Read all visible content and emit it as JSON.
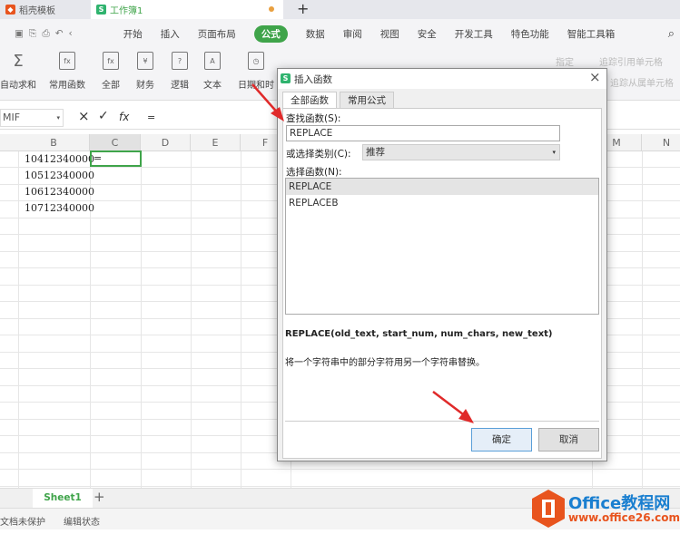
{
  "tabs": [
    {
      "label": "稻壳模板",
      "icon": "docer-logo-icon",
      "color": "#e8541e"
    },
    {
      "label": "工作簿1",
      "icon": "spreadsheet-logo-icon",
      "color": "#2fb36e"
    }
  ],
  "new_tab": "+",
  "menu": [
    "开始",
    "插入",
    "页面布局",
    "公式",
    "数据",
    "审阅",
    "视图",
    "安全",
    "开发工具",
    "特色功能",
    "智能工具箱"
  ],
  "menu_active": "公式",
  "ribbon": [
    {
      "label": "自动求和",
      "icon": "Σ"
    },
    {
      "label": "常用函数",
      "icon": "fx"
    },
    {
      "label": "全部",
      "icon": "fx"
    },
    {
      "label": "财务",
      "icon": "¥"
    },
    {
      "label": "逻辑",
      "icon": "?"
    },
    {
      "label": "文本",
      "icon": "A"
    },
    {
      "label": "日期和时",
      "icon": "◷"
    }
  ],
  "ribbon_right": [
    "指定",
    "追踪引用单元格",
    "追踪从属单元格"
  ],
  "formula_bar": {
    "name_box": "MIF",
    "cancel": "×",
    "confirm": "✓",
    "fx": "fx",
    "value": "="
  },
  "columns": [
    "B",
    "C",
    "D",
    "E",
    "F",
    "M",
    "N"
  ],
  "cells": [
    "10412340000",
    "10512340000",
    "10612340000",
    "10712340000"
  ],
  "active_cell": "=",
  "sheet": {
    "name": "Sheet1",
    "add": "+"
  },
  "status": [
    "文档未保护",
    "编辑状态"
  ],
  "dialog": {
    "title": "插入函数",
    "close": "×",
    "tabs": [
      "全部函数",
      "常用公式"
    ],
    "search_label": "查找函数(S):",
    "search_value": "REPLACE",
    "category_label": "或选择类别(C):",
    "category_value": "推荐",
    "list_label": "选择函数(N):",
    "functions": [
      "REPLACE",
      "REPLACEB"
    ],
    "signature": "REPLACE(old_text, start_num, num_chars, new_text)",
    "description": "将一个字符串中的部分字符用另一个字符串替换。",
    "ok": "确定",
    "cancel": "取消"
  },
  "watermark": {
    "title": "Office教程网",
    "url": "www.office26.com"
  },
  "colors": {
    "accent": "#3fa44a",
    "arrow": "#e02a2a",
    "watermark": "#e8541e"
  }
}
